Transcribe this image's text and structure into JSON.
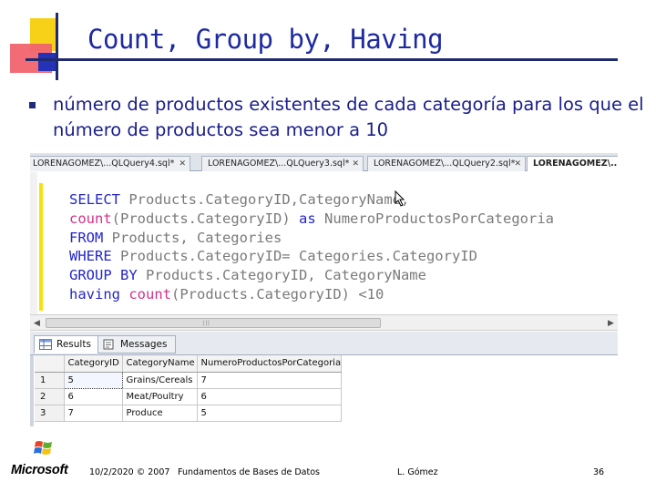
{
  "slide": {
    "title": "Count,  Group by, Having",
    "bullet": "número de productos existentes de cada categoría para los que el número de productos sea menor a 10"
  },
  "editor_tabs": [
    {
      "label": "LORENAGOMEZ\\...QLQuery4.sql*",
      "active": false
    },
    {
      "label": "LORENAGOMEZ\\...QLQuery3.sql*",
      "active": false
    },
    {
      "label": "LORENAGOMEZ\\...QLQuery2.sql*",
      "active": false
    },
    {
      "label": "LORENAGOMEZ\\...Q",
      "active": true
    }
  ],
  "sql": {
    "l1_kw": "SELECT",
    "l1_rest": " Products.Category",
    "l1_id": "ID",
    "l1_rest2": ",Category",
    "l1_name": "Name",
    "l1_end": ",",
    "l2_fn": "count",
    "l2_rest": "(Products.Category",
    "l2_id": "ID",
    "l2_close": ")",
    "l2_as": "as",
    "l2_alias": "NumeroProductosPorCategoria",
    "l3_kw": "FROM",
    "l3_rest": " Products, Categories",
    "l4_kw": "WHERE",
    "l4_rest": " Products.CategoryID= Categories.CategoryID",
    "l5_kw": "GROUP BY",
    "l5_rest": " Products.CategoryID, CategoryName",
    "l6_kw": "having",
    "l6_fn": "count",
    "l6_rest": "(Products.CategoryID) <10"
  },
  "results_tabs": {
    "results": "Results",
    "messages": "Messages"
  },
  "grid": {
    "columns": [
      "CategoryID",
      "CategoryName",
      "NumeroProductosPorCategoria"
    ],
    "rows": [
      {
        "n": "1",
        "id": "5",
        "name": "Grains/Cereals",
        "count": "7"
      },
      {
        "n": "2",
        "id": "6",
        "name": "Meat/Poultry",
        "count": "6"
      },
      {
        "n": "3",
        "id": "7",
        "name": "Produce",
        "count": "5"
      }
    ]
  },
  "footer": {
    "logo": "Microsoft",
    "date": "10/2/2020 © 2007",
    "course": "Fundamentos de Bases de Datos",
    "author": "L. Gómez",
    "page": "36"
  },
  "colors": {
    "title": "#1e2aa0",
    "keyword": "#2426c8",
    "function": "#d2328a"
  }
}
